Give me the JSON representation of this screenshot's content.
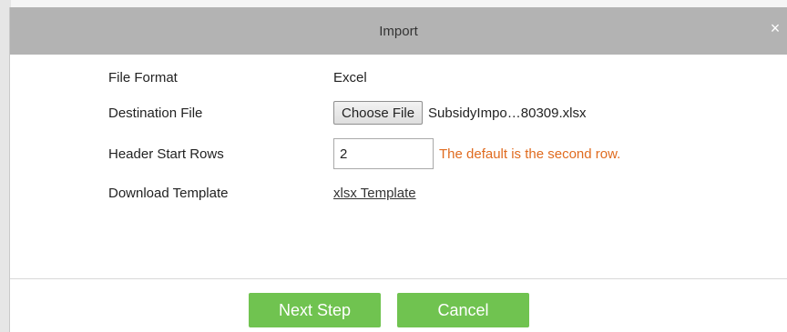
{
  "dialog": {
    "title": "Import",
    "close_icon": "×"
  },
  "form": {
    "file_format": {
      "label": "File Format",
      "value": "Excel"
    },
    "destination_file": {
      "label": "Destination File",
      "button_label": "Choose File",
      "file_name": "SubsidyImpo…80309.xlsx"
    },
    "header_start_rows": {
      "label": "Header Start Rows",
      "value": "2",
      "hint": "The default is the second row."
    },
    "download_template": {
      "label": "Download Template",
      "link_text": "xlsx Template"
    }
  },
  "footer": {
    "next_label": "Next Step",
    "cancel_label": "Cancel"
  },
  "colors": {
    "titlebar": "#b3b3b3",
    "button": "#70c350",
    "hint": "#e06b1f"
  },
  "icons": {
    "close": "close-icon"
  }
}
